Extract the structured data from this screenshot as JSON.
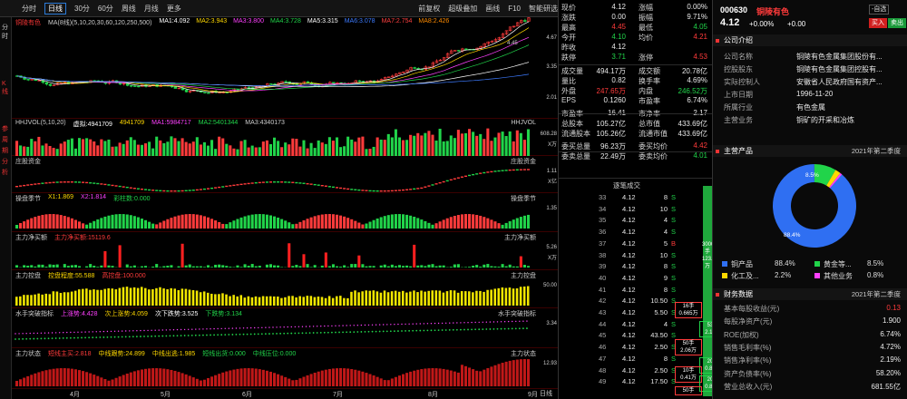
{
  "toolbar": {
    "period_tabs": [
      "分时",
      "日线",
      "30分",
      "60分",
      "周线",
      "月线",
      "更多"
    ],
    "active_tab": "日线",
    "right": [
      "前复权",
      "超级叠加",
      "画线",
      "F10",
      "智能研选"
    ]
  },
  "left_tabs": [
    "分时",
    "K线",
    "参",
    "周",
    "期",
    "分",
    "析"
  ],
  "kline": {
    "stock": "铜陵有色",
    "ma_label": "MA(8线)(5,10,20,30,60,120,250,500)",
    "ma": [
      {
        "t": "MA1:4.092",
        "c": "#ffffff"
      },
      {
        "t": "MA2:3.943",
        "c": "#ffd800"
      },
      {
        "t": "MA3:3.800",
        "c": "#ff40ff"
      },
      {
        "t": "MA4:3.728",
        "c": "#21d44a"
      },
      {
        "t": "MA5:3.315",
        "c": "#ffffff"
      },
      {
        "t": "MA6:3.078",
        "c": "#3d7bff"
      },
      {
        "t": "MA7:2.754",
        "c": "#ff4040"
      },
      {
        "t": "MA8:2.426",
        "c": "#ff8c00"
      }
    ],
    "scale": [
      "4.67",
      "3.35",
      "2.01"
    ],
    "high_mark": "4.45"
  },
  "panels": [
    {
      "left": [
        "HHJVOL(5,10,20)",
        "虚拟:4941709",
        "4941709",
        "MA1:5984717",
        "MA2:5401344",
        "MA3:4340173"
      ],
      "right": "HHJVOL",
      "scale": [
        "608.28",
        "X万"
      ]
    },
    {
      "left": [
        "庄股资金"
      ],
      "right": "庄股资金",
      "scale": [
        "1.11",
        "X亿"
      ]
    },
    {
      "left": [
        "操盘季节",
        "X1:1.869",
        "X2:1.814",
        "彩柱数:0.000"
      ],
      "right": "操盘季节",
      "scale": [
        "1.35"
      ]
    },
    {
      "left": [
        "主力净买额",
        "主力净买额:15119.6"
      ],
      "right": "主力净买额",
      "scale": [
        "5.26",
        "X万"
      ]
    },
    {
      "left": [
        "主力控盘",
        "控盘程度:55.588",
        "高控盘:100.000"
      ],
      "right": "主力控盘",
      "scale": [
        "50.00"
      ]
    },
    {
      "left": [
        "水手突破指标",
        "上涨势:4.428",
        "次上涨势:4.059",
        "次下跌势:3.525",
        "下跌势:3.134"
      ],
      "right": "水手突破指标",
      "scale": [
        "3.34"
      ]
    },
    {
      "left": [
        "主力状态",
        "短线主买:2.818",
        "中线跟势:24.899",
        "中线出逃:1.985",
        "短线出货:0.000",
        "中线压位:0.000"
      ],
      "right": "主力状态",
      "scale": [
        "12.93"
      ]
    }
  ],
  "xaxis": [
    "4月",
    "5月",
    "6月",
    "7月",
    "8月",
    "9月"
  ],
  "xaxis_right": "日线",
  "quote": {
    "rows": [
      [
        "现价",
        "4.12",
        "white",
        "涨幅",
        "0.00%",
        "white"
      ],
      [
        "涨跌",
        "0.00",
        "white",
        "振幅",
        "9.71%",
        "white"
      ],
      [
        "最高",
        "4.45",
        "red",
        "最低",
        "4.05",
        "green"
      ],
      [
        "今开",
        "4.10",
        "green",
        "均价",
        "4.21",
        "red"
      ],
      [
        "昨收",
        "4.12",
        "white",
        "",
        "",
        ""
      ],
      [
        "跌停",
        "3.71",
        "green",
        "涨停",
        "4.53",
        "red"
      ],
      [
        "成交量",
        "494.17万",
        "white",
        "成交额",
        "20.78亿",
        "white"
      ],
      [
        "量比",
        "0.82",
        "white",
        "换手率",
        "4.69%",
        "white"
      ],
      [
        "外盘",
        "247.65万",
        "red",
        "内盘",
        "246.52万",
        "green"
      ],
      [
        "EPS",
        "0.1260",
        "white",
        "市盈率",
        "6.74%",
        "white"
      ],
      [
        "市盈率",
        "16.41",
        "white",
        "市净率",
        "2.17",
        "white"
      ],
      [
        "总股本",
        "105.27亿",
        "white",
        "总市值",
        "433.69亿",
        "white"
      ],
      [
        "流通股本",
        "105.26亿",
        "white",
        "流通市值",
        "433.69亿",
        "white"
      ],
      [
        "委买总量",
        "96.23万",
        "white",
        "委买均价",
        "4.42",
        "red"
      ],
      [
        "委卖总量",
        "22.49万",
        "white",
        "委卖均价",
        "4.01",
        "green"
      ]
    ],
    "trades_header": "逐笔成交",
    "trades": [
      [
        "33",
        "4.12",
        "8",
        "S"
      ],
      [
        "34",
        "4.12",
        "10",
        "S"
      ],
      [
        "35",
        "4.12",
        "4",
        "S"
      ],
      [
        "36",
        "4.12",
        "4",
        "S"
      ],
      [
        "37",
        "4.12",
        "5",
        "B"
      ],
      [
        "38",
        "4.12",
        "10",
        "S"
      ],
      [
        "39",
        "4.12",
        "8",
        "S"
      ],
      [
        "40",
        "4.12",
        "9",
        "S"
      ],
      [
        "41",
        "4.12",
        "8",
        "S"
      ],
      [
        "42",
        "4.12",
        "10.50",
        "S"
      ],
      [
        "43",
        "4.12",
        "5.50",
        "S"
      ],
      [
        "44",
        "4.12",
        "4",
        "S"
      ],
      [
        "45",
        "4.12",
        "43.50",
        "S"
      ],
      [
        "46",
        "4.12",
        "2.50",
        "S"
      ],
      [
        "47",
        "4.12",
        "8",
        "S"
      ],
      [
        "48",
        "4.12",
        "2.50",
        "S"
      ],
      [
        "49",
        "4.12",
        "17.50",
        "S"
      ]
    ],
    "boxes": [
      [
        "3000手",
        "123.60万"
      ],
      [
        "16手",
        "0.665万"
      ],
      [
        "53手",
        "2.18万"
      ],
      [
        "50手",
        "2.06万"
      ],
      [
        "20手",
        "0.82万"
      ],
      [
        "10手",
        "0.41万"
      ],
      [
        "20手",
        "0.82万"
      ],
      [
        "50手",
        ""
      ]
    ]
  },
  "info": {
    "code": "000630",
    "name": "铜陵有色",
    "price": "4.12",
    "chg": "+0.00%",
    "chg2": "+0.00",
    "btn_self": "-自选",
    "btn_buy": "买入",
    "btn_sell": "卖出",
    "company_title": "公司介绍",
    "company": [
      [
        "公司名称",
        "铜陵有色金属集团股份有..."
      ],
      [
        "控股股东",
        "铜陵有色金属集团控股有..."
      ],
      [
        "实际控制人",
        "安徽省人民政府国有资产..."
      ],
      [
        "上市日期",
        "1996-11-20"
      ],
      [
        "所属行业",
        "有色金属"
      ],
      [
        "主营业务",
        "铜矿的开采和冶炼"
      ]
    ],
    "products_title": "主营产品",
    "products_period": "2021年第二季度",
    "pie": [
      {
        "name": "铜产品",
        "pct": "88.4%",
        "v": 88.4,
        "c": "#2f6ff2"
      },
      {
        "name": "黄金等...",
        "pct": "8.5%",
        "v": 8.5,
        "c": "#21d44a"
      },
      {
        "name": "化工及...",
        "pct": "2.2%",
        "v": 2.2,
        "c": "#ffd800"
      },
      {
        "name": "其他业务",
        "pct": "0.8%",
        "v": 0.8,
        "c": "#ff40ff"
      }
    ],
    "pie_label_big": "88.4%",
    "pie_label_small": "8.5%",
    "fin_title": "财务数据",
    "fin_period": "2021年第二季度",
    "fin": [
      [
        "基本每股收益(元)",
        "0.13",
        "red"
      ],
      [
        "每股净资产(元)",
        "1.900",
        "white"
      ],
      [
        "ROE(加权)",
        "6.74%",
        "white"
      ],
      [
        "销售毛利率(%)",
        "4.72%",
        "white"
      ],
      [
        "销售净利率(%)",
        "2.19%",
        "white"
      ],
      [
        "资产负债率(%)",
        "58.20%",
        "white"
      ],
      [
        "营业总收入(元)",
        "681.55亿",
        "white"
      ]
    ]
  }
}
